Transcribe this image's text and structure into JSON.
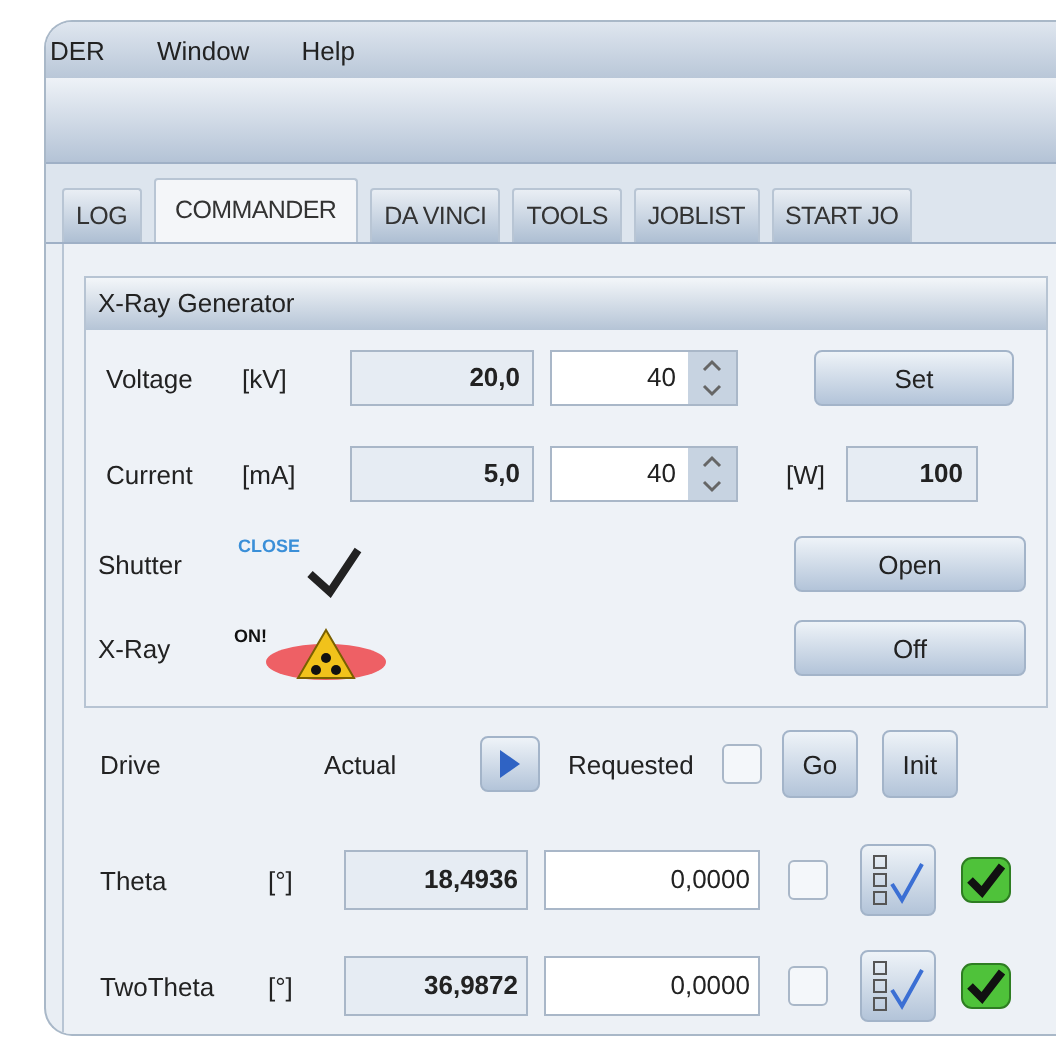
{
  "menu": [
    {
      "label": "DER"
    },
    {
      "label": "Window"
    },
    {
      "label": "Help"
    }
  ],
  "tabs": [
    {
      "label": "LOG",
      "selected": false
    },
    {
      "label": "COMMANDER",
      "selected": true
    },
    {
      "label": "DA VINCI",
      "selected": false
    },
    {
      "label": "TOOLS",
      "selected": false
    },
    {
      "label": "JOBLIST",
      "selected": false
    },
    {
      "label": "START JO",
      "selected": false
    }
  ],
  "xray_generator": {
    "title": "X-Ray Generator",
    "rows": [
      {
        "label": "Voltage",
        "unit": "[kV]",
        "actual": "20,0",
        "setpoint": "40"
      },
      {
        "label": "Current",
        "unit": "[mA]",
        "actual": "5,0",
        "setpoint": "40"
      }
    ],
    "set_button": "Set",
    "power_unit": "[W]",
    "power": "100",
    "shutter": {
      "label": "Shutter",
      "status": "CLOSE",
      "button": "Open"
    },
    "xray": {
      "label": "X-Ray",
      "status": "ON!",
      "on": true,
      "button": "Off"
    }
  },
  "drive": {
    "label": "Drive",
    "actual_label": "Actual",
    "requested_label": "Requested",
    "checked": false,
    "go_button": "Go",
    "init_button": "Init",
    "axes": [
      {
        "name": "Theta",
        "unit": "[°]",
        "actual": "18,4936",
        "requested": "0,0000",
        "checked": false,
        "ok": true
      },
      {
        "name": "TwoTheta",
        "unit": "[°]",
        "actual": "36,9872",
        "requested": "0,0000",
        "checked": false,
        "ok": true
      }
    ]
  }
}
